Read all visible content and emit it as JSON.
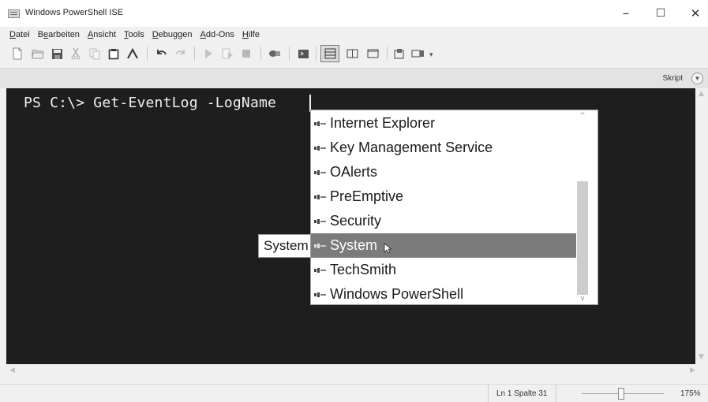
{
  "window": {
    "title": "Windows PowerShell ISE",
    "controls": {
      "minimize": "–",
      "maximize": "☐",
      "close": "✕"
    }
  },
  "menu": {
    "items": [
      {
        "pre": "",
        "u": "D",
        "post": "atei"
      },
      {
        "pre": "B",
        "u": "e",
        "post": "arbeiten"
      },
      {
        "pre": "",
        "u": "A",
        "post": "nsicht"
      },
      {
        "pre": "",
        "u": "T",
        "post": "ools"
      },
      {
        "pre": "",
        "u": "D",
        "post": "ebuggen"
      },
      {
        "pre": "",
        "u": "A",
        "post": "dd-Ons"
      },
      {
        "pre": "",
        "u": "H",
        "post": "ilfe"
      }
    ]
  },
  "toolbar": {
    "icons": [
      "new-file-icon",
      "open-folder-icon",
      "save-icon",
      "cut-icon",
      "copy-icon",
      "paste-icon",
      "clear-console-icon",
      "undo-icon",
      "redo-icon",
      "run-script-icon",
      "run-selection-icon",
      "stop-icon",
      "new-remote-tab-icon",
      "start-powershell-icon",
      "layout-script-top-icon",
      "layout-script-right-icon",
      "layout-script-max-icon",
      "show-script-pane-icon",
      "show-commands-icon"
    ]
  },
  "tabbar": {
    "skript_label": "Skript",
    "toggle_icon": "chevron-down-icon"
  },
  "editor": {
    "prompt_text": "PS C:\\> Get-EventLog -LogName ",
    "tooltip": "System"
  },
  "intellisense": {
    "item_icon": "enum-value-icon",
    "items": [
      {
        "label": "Internet Explorer",
        "selected": false
      },
      {
        "label": "Key Management Service",
        "selected": false
      },
      {
        "label": "OAlerts",
        "selected": false
      },
      {
        "label": "PreEmptive",
        "selected": false
      },
      {
        "label": "Security",
        "selected": false
      },
      {
        "label": "System",
        "selected": true
      },
      {
        "label": "TechSmith",
        "selected": false
      },
      {
        "label": "Windows PowerShell",
        "selected": false
      }
    ]
  },
  "status": {
    "position": "Ln 1  Spalte 31",
    "zoom": "175%"
  },
  "colors": {
    "editor_bg": "#1e1e1e",
    "editor_fg": "#f0f0f0",
    "selected_item_bg": "#7b7b7b",
    "chrome_bg": "#f0f0f0"
  }
}
